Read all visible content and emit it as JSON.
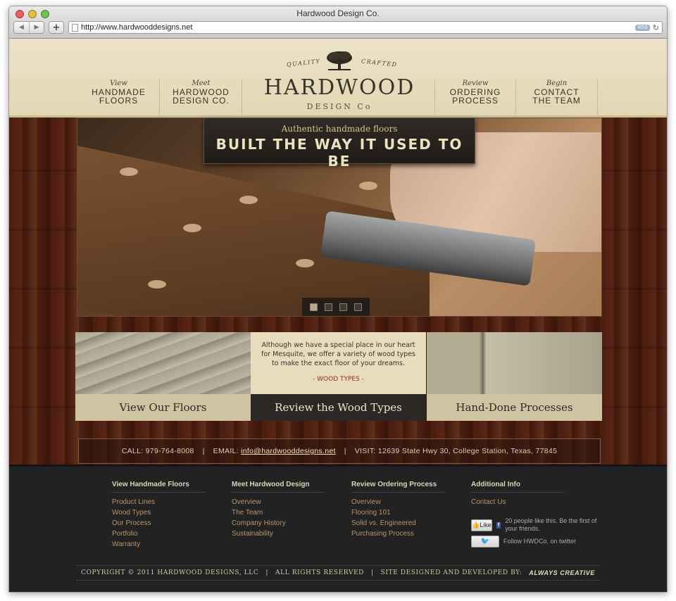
{
  "window": {
    "title": "Hardwood Design Co.",
    "url": "http://www.hardwooddesigns.net",
    "rss": "RSS"
  },
  "nav": {
    "items": [
      {
        "pre": "View",
        "label": "HANDMADE\nFLOORS"
      },
      {
        "pre": "Meet",
        "label": "HARDWOOD\nDESIGN CO."
      },
      {
        "pre": "Review",
        "label": "ORDERING\nPROCESS"
      },
      {
        "pre": "Begin",
        "label": "CONTACT\nTHE TEAM"
      }
    ]
  },
  "logo": {
    "quality": "QUALITY",
    "crafted": "CRAFTED",
    "brand": "HARDWOOD",
    "sub": "DESIGN Co"
  },
  "hero": {
    "tagline": "Authentic handmade floors",
    "headline": "BUILT THE WAY IT USED TO BE",
    "slides": 4,
    "active_slide": 1
  },
  "features": [
    {
      "caption": "View Our Floors"
    },
    {
      "caption": "Review the Wood Types",
      "text": "Although we have a special place in our heart for Mesquite, we offer a variety of wood types to make the exact floor of your dreams.",
      "link": "- WOOD TYPES -"
    },
    {
      "caption": "Hand-Done Processes"
    }
  ],
  "contact": {
    "call": "CALL:  979-764-8008",
    "email_label": "EMAIL:",
    "email": "info@hardwooddesigns.net",
    "visit": "VISIT:  12639 State Hwy 30, College Station, Texas, 77845",
    "sep": "|"
  },
  "footer": {
    "columns": [
      {
        "heading": "View Handmade Floors",
        "links": [
          "Product Lines",
          "Wood Types",
          "Our Process",
          "Portfolio",
          "Warranty"
        ]
      },
      {
        "heading": "Meet Hardwood Design",
        "links": [
          "Overview",
          "The Team",
          "Company History",
          "Sustainability"
        ]
      },
      {
        "heading": "Review Ordering Process",
        "links": [
          "Overview",
          "Flooring 101",
          "Solid vs. Engineered",
          "Purchasing Process"
        ]
      },
      {
        "heading": "Additional Info",
        "links": [
          "Contact Us"
        ]
      }
    ],
    "like_label": "Like",
    "like_text": "20 people like this. Be the first of your friends.",
    "twitter_text": "Follow HWDCo. on twitter",
    "copyright": "COPYRIGHT © 2011 HARDWOOD DESIGNS, LLC",
    "rights": "ALL RIGHTS RESERVED",
    "designed": "SITE DESIGNED AND DEVELOPED BY:",
    "designer": "ALWAYS CREATIVE",
    "sep": "|"
  }
}
